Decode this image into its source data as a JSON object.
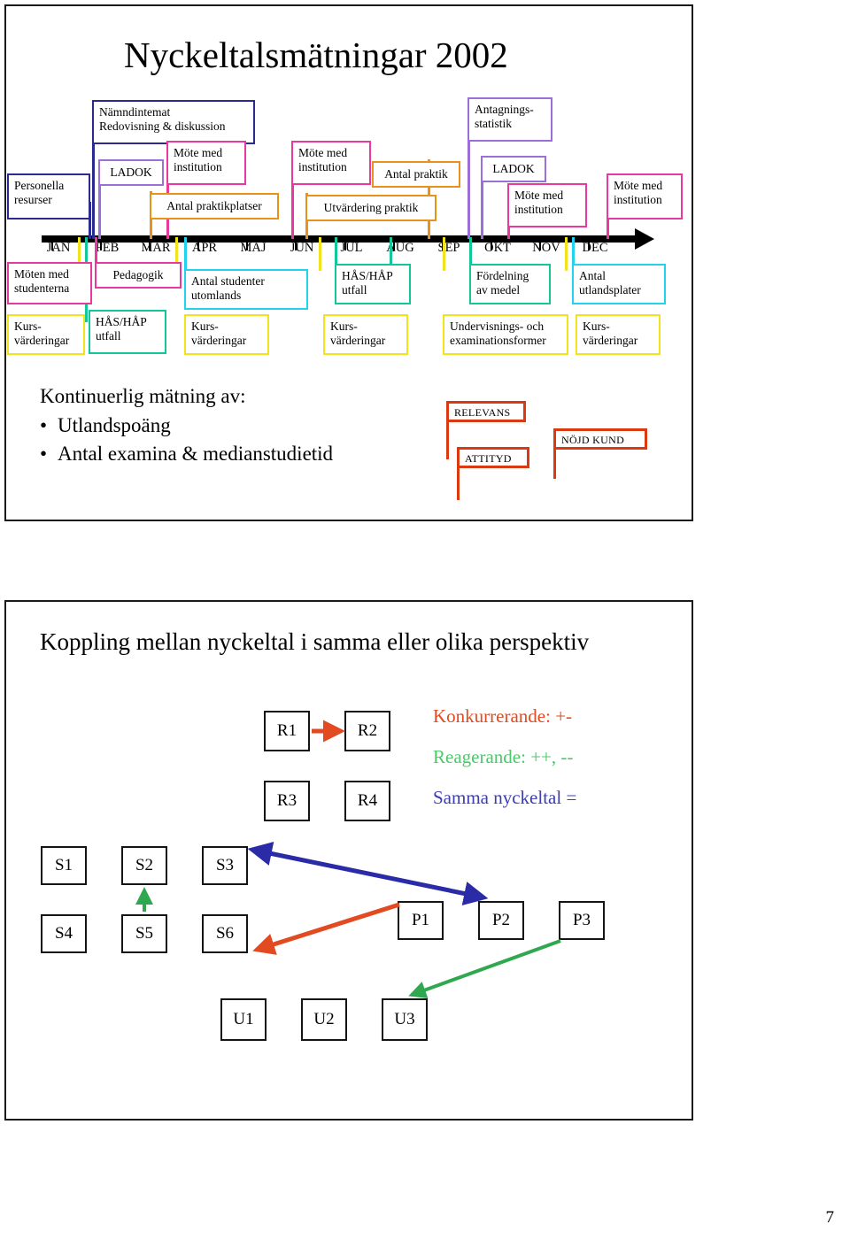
{
  "page_number": "7",
  "slide1": {
    "title": "Nyckeltalsmätningar 2002",
    "months": [
      "JAN",
      "FEB",
      "MAR",
      "APR",
      "MAJ",
      "JUN",
      "JUL",
      "AUG",
      "SEP",
      "OKT",
      "NOV",
      "DEC"
    ],
    "upper_events": [
      {
        "id": "personella-resurser",
        "label": "Personella\nresurser",
        "color": "#2B2B8F"
      },
      {
        "id": "namndintemat",
        "label": "Nämndintemat\nRedovisning & diskussion",
        "color": "#2B2B8F"
      },
      {
        "id": "ladok-feb",
        "label": "LADOK",
        "color": "#9B6FD6"
      },
      {
        "id": "mote-med-institution-mar",
        "label": "Möte med\ninstitution",
        "color": "#E8399F"
      },
      {
        "id": "antal-praktikplatser",
        "label": "Antal praktikplatser",
        "color": "#E8921A"
      },
      {
        "id": "mote-med-institution-jun",
        "label": "Möte med\ninstitution",
        "color": "#E8399F"
      },
      {
        "id": "utvardering-praktik",
        "label": "Utvärdering praktik",
        "color": "#E8921A"
      },
      {
        "id": "antal-praktik",
        "label": "Antal praktik",
        "color": "#E8921A"
      },
      {
        "id": "antagningsstatistik",
        "label": "Antagnings-\nstatistik",
        "color": "#9B6FD6"
      },
      {
        "id": "ladok-sep",
        "label": "LADOK",
        "color": "#9B6FD6"
      },
      {
        "id": "mote-med-institution-okt",
        "label": "Möte med\ninstitution",
        "color": "#E8399F"
      },
      {
        "id": "mote-med-institution-dec",
        "label": "Möte med\ninstitution",
        "color": "#E8399F"
      }
    ],
    "lower_events": [
      {
        "id": "moten-med-studenterna",
        "label": "Möten med\nstudenterna",
        "color": "#E8399F"
      },
      {
        "id": "pedagogik",
        "label": "Pedagogik",
        "color": "#E8399F"
      },
      {
        "id": "antal-studenter-utomlands",
        "label": "Antal studenter\nutomlands",
        "color": "#22D3EE"
      },
      {
        "id": "has-hap-utfall-jul",
        "label": "HÅS/HÅP\nutfall",
        "color": "#13C79A"
      },
      {
        "id": "fordelning-av-medel",
        "label": "Fördelning\nav medel",
        "color": "#13C79A"
      },
      {
        "id": "antal-utlandsplater",
        "label": "Antal\nutlandsplater",
        "color": "#22D3EE"
      },
      {
        "id": "kursvarderingar-jan",
        "label": "Kurs-\nvärderingar",
        "color": "#F2E41C"
      },
      {
        "id": "has-hap-utfall-feb",
        "label": "HÅS/HÅP\nutfall",
        "color": "#13C79A"
      },
      {
        "id": "kursvarderingar-apr",
        "label": "Kurs-\nvärderingar",
        "color": "#F2E41C"
      },
      {
        "id": "kursvarderingar-jul",
        "label": "Kurs-\nvärderingar",
        "color": "#F2E41C"
      },
      {
        "id": "undervisnings-och-examinationsformer",
        "label": "Undervisnings- och\nexaminationsformer",
        "color": "#F2E41C"
      },
      {
        "id": "kursvarderingar-dec",
        "label": "Kurs-\nvärderingar",
        "color": "#F2E41C"
      }
    ],
    "continuous": {
      "heading": "Kontinuerlig mätning av:",
      "items": [
        "Utlandspoäng",
        "Antal examina & medianstudietid"
      ]
    },
    "flags": [
      {
        "id": "relevans",
        "label": "RELEVANS"
      },
      {
        "id": "attityd",
        "label": "ATTITYD"
      },
      {
        "id": "nojd-kund",
        "label": "NÖJD KUND"
      }
    ],
    "flag_color": "#D93A12"
  },
  "slide2": {
    "title": "Koppling mellan nyckeltal i samma eller olika perspektiv",
    "r_boxes": [
      "R1",
      "R2",
      "R3",
      "R4"
    ],
    "s_boxes": [
      "S1",
      "S2",
      "S3",
      "S4",
      "S5",
      "S6"
    ],
    "p_boxes": [
      "P1",
      "P2",
      "P3"
    ],
    "u_boxes": [
      "U1",
      "U2",
      "U3"
    ],
    "legend": [
      {
        "id": "konkurrerande",
        "text": "Konkurrerande: +-",
        "color": "#E24A22"
      },
      {
        "id": "reagerande",
        "text": "Reagerande: ++, --",
        "color": "#4BC96A"
      },
      {
        "id": "samma-nyckeltal",
        "text": "Samma nyckeltal  =",
        "color": "#3C3CB4"
      }
    ],
    "arrow_colors": {
      "red": "#E24A22",
      "green": "#2FA84F",
      "blue": "#2B2BA8"
    }
  }
}
